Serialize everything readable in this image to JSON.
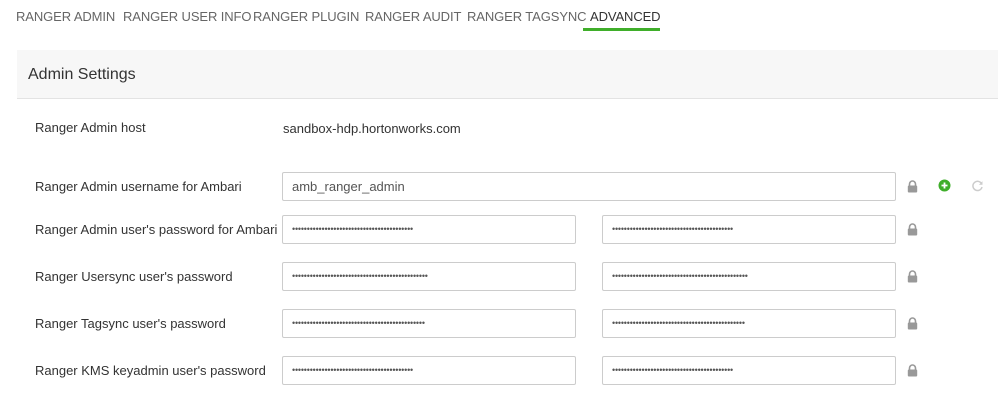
{
  "tabs": [
    {
      "label": "RANGER ADMIN"
    },
    {
      "label": "RANGER USER INFO"
    },
    {
      "label": "RANGER PLUGIN"
    },
    {
      "label": "RANGER AUDIT"
    },
    {
      "label": "RANGER TAGSYNC"
    },
    {
      "label": "ADVANCED",
      "active": true
    }
  ],
  "section": {
    "title": "Admin Settings"
  },
  "host": {
    "label": "Ranger Admin host",
    "value": "sandbox-hdp.hortonworks.com"
  },
  "fields": [
    {
      "label": "Ranger Admin username for Ambari",
      "value": "amb_ranger_admin"
    },
    {
      "label": "Ranger Admin user's password for Ambari",
      "password": "•••••••••••••••••••••••••••••••••••••••••",
      "confirm": "•••••••••••••••••••••••••••••••••••••••••"
    },
    {
      "label": "Ranger Usersync user's password",
      "password": "••••••••••••••••••••••••••••••••••••••••••••••",
      "confirm": "••••••••••••••••••••••••••••••••••••••••••••••"
    },
    {
      "label": "Ranger Tagsync user's password",
      "password": "•••••••••••••••••••••••••••••••••••••••••••••",
      "confirm": "•••••••••••••••••••••••••••••••••••••••••••••"
    },
    {
      "label": "Ranger KMS keyadmin user's password",
      "password": "•••••••••••••••••••••••••••••••••••••••••",
      "confirm": "•••••••••••••••••••••••••••••••••••••••••"
    }
  ],
  "colors": {
    "accent": "#3fae2a",
    "icon": "#999999",
    "add": "#3fae2a",
    "refresh": "#cccccc"
  },
  "icons": {
    "lock": "lock-icon",
    "add": "plus-circle-icon",
    "refresh": "refresh-icon"
  }
}
